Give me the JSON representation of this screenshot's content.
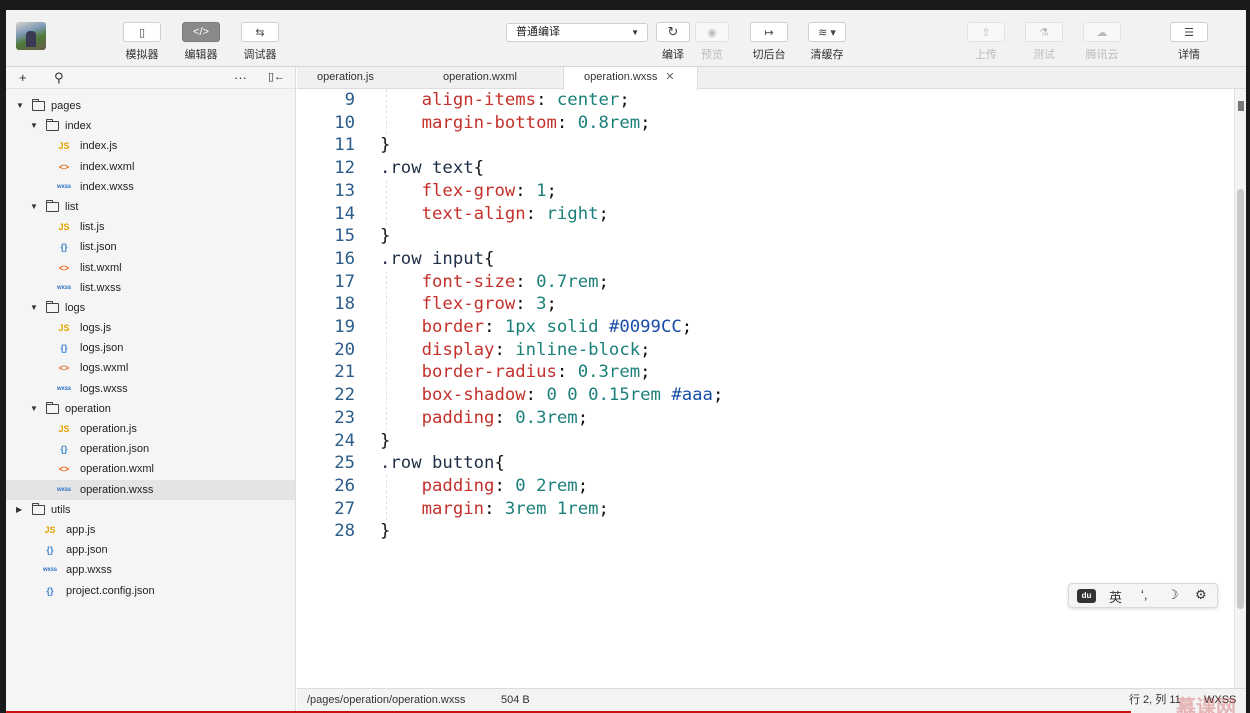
{
  "toolbar": {
    "left_buttons": [
      {
        "icon": "phone-icon",
        "glyph": "▯",
        "label": "模拟器"
      },
      {
        "icon": "code-icon",
        "glyph": "</>",
        "label": "编辑器"
      },
      {
        "icon": "debug-icon",
        "glyph": "⇆",
        "label": "调试器"
      }
    ],
    "compile_mode": "普通编译",
    "compile_label": "编译",
    "preview_label": "预览",
    "background_label": "切后台",
    "clear_cache_label": "清缓存",
    "upload_label": "上传",
    "test_label": "测试",
    "cloud_label": "腾讯云",
    "details_label": "详情"
  },
  "sidebar": {
    "tree": [
      {
        "type": "folder",
        "depth": 0,
        "open": true,
        "name": "pages"
      },
      {
        "type": "folder",
        "depth": 1,
        "open": true,
        "name": "index"
      },
      {
        "type": "file",
        "depth": 2,
        "kind": "js",
        "tag": "JS",
        "name": "index.js"
      },
      {
        "type": "file",
        "depth": 2,
        "kind": "wxml",
        "tag": "<>",
        "name": "index.wxml"
      },
      {
        "type": "file",
        "depth": 2,
        "kind": "wxss",
        "tag": "wxss",
        "name": "index.wxss"
      },
      {
        "type": "folder",
        "depth": 1,
        "open": true,
        "name": "list"
      },
      {
        "type": "file",
        "depth": 2,
        "kind": "js",
        "tag": "JS",
        "name": "list.js"
      },
      {
        "type": "file",
        "depth": 2,
        "kind": "json",
        "tag": "{}",
        "name": "list.json"
      },
      {
        "type": "file",
        "depth": 2,
        "kind": "wxml",
        "tag": "<>",
        "name": "list.wxml"
      },
      {
        "type": "file",
        "depth": 2,
        "kind": "wxss",
        "tag": "wxss",
        "name": "list.wxss"
      },
      {
        "type": "folder",
        "depth": 1,
        "open": true,
        "name": "logs"
      },
      {
        "type": "file",
        "depth": 2,
        "kind": "js",
        "tag": "JS",
        "name": "logs.js"
      },
      {
        "type": "file",
        "depth": 2,
        "kind": "json",
        "tag": "{}",
        "name": "logs.json"
      },
      {
        "type": "file",
        "depth": 2,
        "kind": "wxml",
        "tag": "<>",
        "name": "logs.wxml"
      },
      {
        "type": "file",
        "depth": 2,
        "kind": "wxss",
        "tag": "wxss",
        "name": "logs.wxss"
      },
      {
        "type": "folder",
        "depth": 1,
        "open": true,
        "name": "operation"
      },
      {
        "type": "file",
        "depth": 2,
        "kind": "js",
        "tag": "JS",
        "name": "operation.js"
      },
      {
        "type": "file",
        "depth": 2,
        "kind": "json",
        "tag": "{}",
        "name": "operation.json"
      },
      {
        "type": "file",
        "depth": 2,
        "kind": "wxml",
        "tag": "<>",
        "name": "operation.wxml"
      },
      {
        "type": "file",
        "depth": 2,
        "kind": "wxss",
        "tag": "wxss",
        "name": "operation.wxss",
        "selected": true
      },
      {
        "type": "folder",
        "depth": 0,
        "open": false,
        "name": "utils"
      },
      {
        "type": "file",
        "depth": 1,
        "kind": "js",
        "tag": "JS",
        "name": "app.js"
      },
      {
        "type": "file",
        "depth": 1,
        "kind": "json",
        "tag": "{}",
        "name": "app.json"
      },
      {
        "type": "file",
        "depth": 1,
        "kind": "wxss",
        "tag": "wxss",
        "name": "app.wxss"
      },
      {
        "type": "file",
        "depth": 1,
        "kind": "json",
        "tag": "{}",
        "name": "project.config.json"
      }
    ]
  },
  "editor": {
    "tabs": [
      {
        "name": "operation.js"
      },
      {
        "name": "operation.wxml"
      },
      {
        "name": "operation.wxss",
        "active": true
      }
    ],
    "lines": [
      {
        "n": "9",
        "tokens": [
          [
            "i",
            "    "
          ],
          [
            "prop",
            "align-items"
          ],
          [
            "punc",
            ": "
          ],
          [
            "val",
            "center"
          ],
          [
            "punc",
            ";"
          ]
        ]
      },
      {
        "n": "10",
        "tokens": [
          [
            "i",
            "    "
          ],
          [
            "prop",
            "margin-bottom"
          ],
          [
            "punc",
            ": "
          ],
          [
            "val",
            "0.8rem"
          ],
          [
            "punc",
            ";"
          ]
        ]
      },
      {
        "n": "11",
        "tokens": [
          [
            "punc",
            "}"
          ]
        ]
      },
      {
        "n": "12",
        "tokens": [
          [
            "sel",
            ".row text"
          ],
          [
            "punc",
            "{"
          ]
        ]
      },
      {
        "n": "13",
        "tokens": [
          [
            "i",
            "    "
          ],
          [
            "prop",
            "flex-grow"
          ],
          [
            "punc",
            ": "
          ],
          [
            "val",
            "1"
          ],
          [
            "punc",
            ";"
          ]
        ]
      },
      {
        "n": "14",
        "tokens": [
          [
            "i",
            "    "
          ],
          [
            "prop",
            "text-align"
          ],
          [
            "punc",
            ": "
          ],
          [
            "val",
            "right"
          ],
          [
            "punc",
            ";"
          ]
        ]
      },
      {
        "n": "15",
        "tokens": [
          [
            "punc",
            "}"
          ]
        ]
      },
      {
        "n": "16",
        "tokens": [
          [
            "sel",
            ".row input"
          ],
          [
            "punc",
            "{"
          ]
        ]
      },
      {
        "n": "17",
        "tokens": [
          [
            "i",
            "    "
          ],
          [
            "prop",
            "font-size"
          ],
          [
            "punc",
            ": "
          ],
          [
            "val",
            "0.7rem"
          ],
          [
            "punc",
            ";"
          ]
        ]
      },
      {
        "n": "18",
        "tokens": [
          [
            "i",
            "    "
          ],
          [
            "prop",
            "flex-grow"
          ],
          [
            "punc",
            ": "
          ],
          [
            "val",
            "3"
          ],
          [
            "punc",
            ";"
          ]
        ]
      },
      {
        "n": "19",
        "tokens": [
          [
            "i",
            "    "
          ],
          [
            "prop",
            "border"
          ],
          [
            "punc",
            ": "
          ],
          [
            "val",
            "1px solid "
          ],
          [
            "hex",
            "#0099CC"
          ],
          [
            "punc",
            ";"
          ]
        ]
      },
      {
        "n": "20",
        "tokens": [
          [
            "i",
            "    "
          ],
          [
            "prop",
            "display"
          ],
          [
            "punc",
            ": "
          ],
          [
            "val",
            "inline-block"
          ],
          [
            "punc",
            ";"
          ]
        ]
      },
      {
        "n": "21",
        "tokens": [
          [
            "i",
            "    "
          ],
          [
            "prop",
            "border-radius"
          ],
          [
            "punc",
            ": "
          ],
          [
            "val",
            "0.3rem"
          ],
          [
            "punc",
            ";"
          ]
        ]
      },
      {
        "n": "22",
        "tokens": [
          [
            "i",
            "    "
          ],
          [
            "prop",
            "box-shadow"
          ],
          [
            "punc",
            ": "
          ],
          [
            "val",
            "0 0 0.15rem "
          ],
          [
            "hex",
            "#aaa"
          ],
          [
            "punc",
            ";"
          ]
        ]
      },
      {
        "n": "23",
        "tokens": [
          [
            "i",
            "    "
          ],
          [
            "prop",
            "padding"
          ],
          [
            "punc",
            ": "
          ],
          [
            "val",
            "0.3rem"
          ],
          [
            "punc",
            ";"
          ]
        ]
      },
      {
        "n": "24",
        "tokens": [
          [
            "punc",
            "}"
          ]
        ]
      },
      {
        "n": "25",
        "tokens": [
          [
            "sel",
            ".row button"
          ],
          [
            "punc",
            "{"
          ]
        ]
      },
      {
        "n": "26",
        "tokens": [
          [
            "i",
            "    "
          ],
          [
            "prop",
            "padding"
          ],
          [
            "punc",
            ": "
          ],
          [
            "val",
            "0 2rem"
          ],
          [
            "punc",
            ";"
          ]
        ]
      },
      {
        "n": "27",
        "tokens": [
          [
            "i",
            "    "
          ],
          [
            "prop",
            "margin"
          ],
          [
            "punc",
            ": "
          ],
          [
            "val",
            "3rem 1rem"
          ],
          [
            "punc",
            ";"
          ]
        ]
      },
      {
        "n": "28",
        "tokens": [
          [
            "punc",
            "}"
          ]
        ]
      }
    ]
  },
  "ime": {
    "lang": "英",
    "punct": "‘,",
    "moon": "☽",
    "gear": "⚙",
    "logo": "du"
  },
  "status": {
    "path": "/pages/operation/operation.wxss",
    "size": "504 B",
    "cursor": "行 2, 列 11",
    "lang": "WXSS"
  },
  "watermark": "慕课网"
}
